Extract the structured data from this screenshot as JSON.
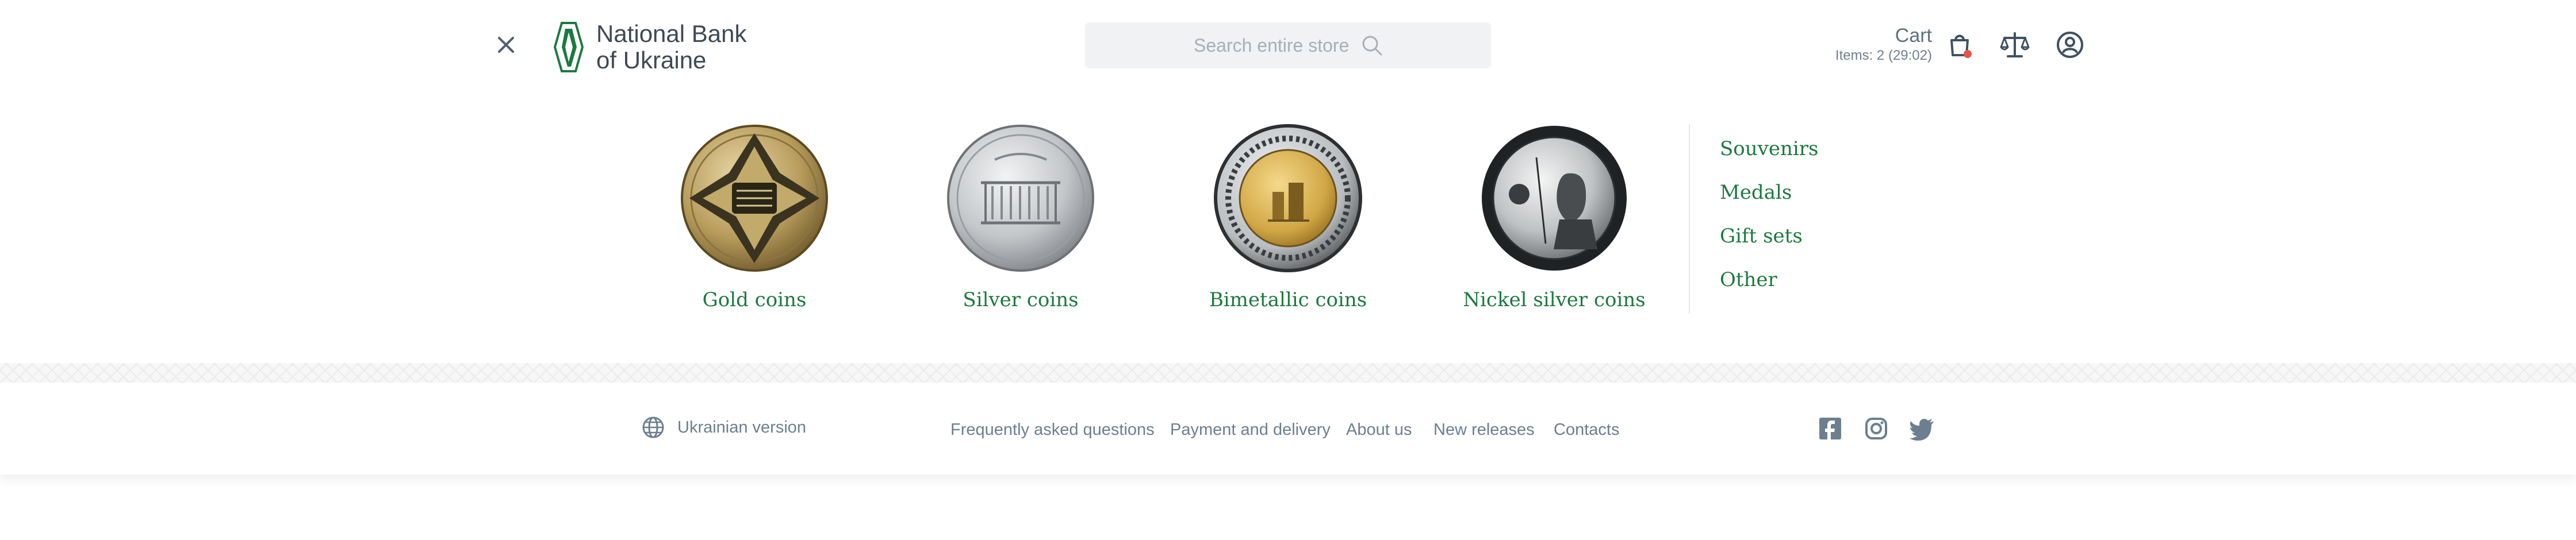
{
  "header": {
    "logo_line1": "National Bank",
    "logo_line2": "of Ukraine",
    "search_placeholder": "Search entire store",
    "cart_title": "Cart",
    "cart_items": "Items: 2 (29:02)"
  },
  "catalog": {
    "coins": [
      {
        "label": "Gold coins"
      },
      {
        "label": "Silver coins"
      },
      {
        "label": "Bimetallic coins"
      },
      {
        "label": "Nickel silver coins"
      }
    ],
    "side_links": [
      {
        "label": "Souvenirs"
      },
      {
        "label": "Medals"
      },
      {
        "label": "Gift sets"
      },
      {
        "label": "Other"
      }
    ]
  },
  "footer": {
    "language": "Ukrainian version",
    "links": [
      {
        "label": "Frequently asked questions"
      },
      {
        "label": "Payment and delivery"
      },
      {
        "label": "About us"
      },
      {
        "label": "New releases"
      },
      {
        "label": "Contacts"
      }
    ],
    "social": [
      "facebook-icon",
      "instagram-icon",
      "twitter-icon"
    ]
  },
  "colors": {
    "brand_green": "#1b7a3e",
    "text_gray": "#6c7f8f",
    "badge_red": "#e2564b"
  }
}
